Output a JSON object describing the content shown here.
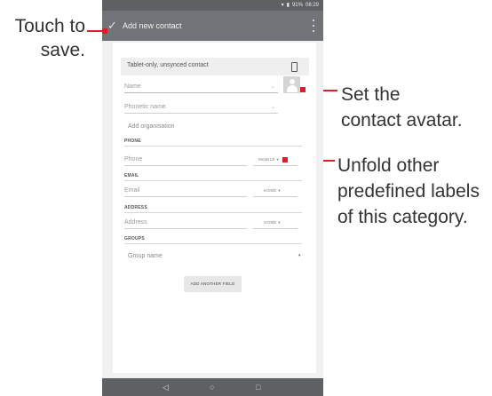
{
  "callouts": {
    "save_line1": "Touch to",
    "save_line2": "save.",
    "avatar_line1": "Set the",
    "avatar_line2": "contact avatar.",
    "unfold_line1": "Unfold other",
    "unfold_line2": "predefined labels",
    "unfold_line3": "of this category."
  },
  "status_bar": {
    "battery": "91%",
    "time": "08:29"
  },
  "app_bar": {
    "title": "Add new contact"
  },
  "account": {
    "label": "Tablet-only, unsynced contact"
  },
  "fields": {
    "name_placeholder": "Name",
    "phonetic_placeholder": "Phonetic name",
    "add_organisation": "Add organisation",
    "phone_header": "PHONE",
    "phone_placeholder": "Phone",
    "phone_type": "MOBILE",
    "email_header": "EMAIL",
    "email_placeholder": "Email",
    "email_type": "HOME",
    "address_header": "ADDRESS",
    "address_placeholder": "Address",
    "address_type": "HOME",
    "groups_header": "GROUPS",
    "group_placeholder": "Group name"
  },
  "add_another_field": "ADD ANOTHER FIELD",
  "nav": {
    "back": "◁",
    "home": "○",
    "recents": "□"
  },
  "colors": {
    "annotation": "#d7202e",
    "app_bar": "#707478",
    "status_bar": "#5d6164"
  }
}
